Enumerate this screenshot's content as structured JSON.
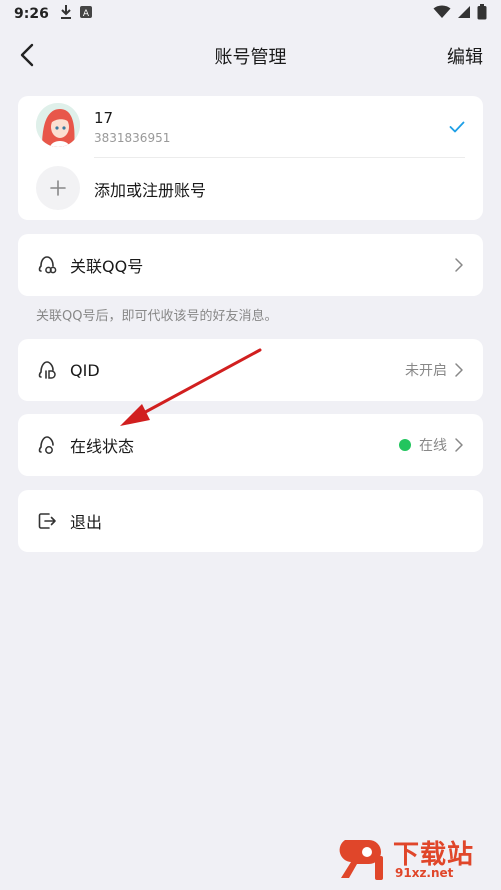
{
  "status_bar": {
    "time": "9:26",
    "icons": [
      "download-icon",
      "a-icon",
      "wifi-icon",
      "signal-icon",
      "battery-icon"
    ]
  },
  "nav": {
    "title": "账号管理",
    "edit_label": "编辑"
  },
  "accounts": {
    "current": {
      "name": "17",
      "qq_number": "3831836951",
      "selected": true
    },
    "add_label": "添加或注册账号"
  },
  "link_qq": {
    "label": "关联QQ号",
    "note": "关联QQ号后，即可代收该号的好友消息。"
  },
  "qid": {
    "label": "QID",
    "value": "未开启"
  },
  "online_status": {
    "label": "在线状态",
    "value": "在线",
    "dot_color": "#22c55e"
  },
  "logout": {
    "label": "退出"
  },
  "watermark": {
    "title": "下载站",
    "subtitle": "91xz.net"
  },
  "colors": {
    "accent": "#1e9fe6",
    "background": "#f0f0f5",
    "annotation_arrow": "#d11f1f",
    "watermark": "#e0462a"
  }
}
